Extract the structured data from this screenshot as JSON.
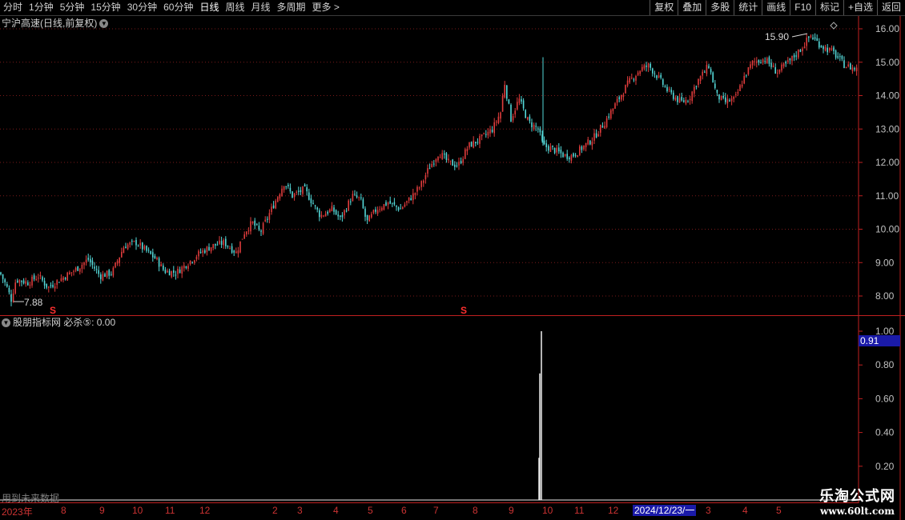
{
  "toolbar": {
    "periods": [
      "分时",
      "1分钟",
      "5分钟",
      "15分钟",
      "30分钟",
      "60分钟",
      "日线",
      "周线",
      "月线",
      "多周期",
      "更多 >"
    ],
    "active_period": "日线",
    "right_buttons": [
      "复权",
      "叠加",
      "多股",
      "统计",
      "画线",
      "F10",
      "标记",
      "+自选",
      "返回"
    ]
  },
  "main_chart": {
    "title": "宁沪高速(日线,前复权)",
    "high_label": "15.90",
    "low_label": "7.88",
    "y_ticks": [
      "16.00",
      "15.00",
      "14.00",
      "13.00",
      "12.00",
      "11.00",
      "10.00",
      "9.00",
      "8.00"
    ],
    "marker_symbol": "S",
    "up_color": "#e03c3c",
    "down_color": "#54d8d8"
  },
  "indicator": {
    "title": "股朋指标网 必杀⑤: 0.00",
    "y_ticks": [
      "1.00",
      "0.80",
      "0.60",
      "0.40",
      "0.20"
    ],
    "current_value_label": "0.91"
  },
  "date_axis": {
    "labels": [
      "2023年",
      "8",
      "9",
      "10",
      "11",
      "12",
      "2",
      "3",
      "4",
      "5",
      "6",
      "7",
      "8",
      "9",
      "10",
      "11",
      "12",
      "3",
      "4",
      "5"
    ],
    "highlight": "2024/12/23/一"
  },
  "future_note": "用到未来数据",
  "watermark": {
    "title": "乐淘公式网",
    "url": "www.60lt.com"
  },
  "chart_data": {
    "type": "candlestick",
    "title": "宁沪高速(日线,前复权)",
    "y_range": [
      7.6,
      16.2
    ],
    "grid": true,
    "close_anchors": [
      [
        0,
        8.7
      ],
      [
        8,
        8.3
      ],
      [
        14,
        7.9
      ],
      [
        20,
        8.5
      ],
      [
        35,
        8.4
      ],
      [
        48,
        8.6
      ],
      [
        60,
        8.25
      ],
      [
        75,
        8.5
      ],
      [
        95,
        8.8
      ],
      [
        110,
        9.1
      ],
      [
        125,
        8.6
      ],
      [
        140,
        8.7
      ],
      [
        155,
        9.5
      ],
      [
        170,
        9.6
      ],
      [
        185,
        9.3
      ],
      [
        195,
        9.1
      ],
      [
        205,
        8.75
      ],
      [
        220,
        8.7
      ],
      [
        235,
        9.0
      ],
      [
        250,
        9.3
      ],
      [
        265,
        9.5
      ],
      [
        280,
        9.6
      ],
      [
        295,
        9.3
      ],
      [
        305,
        9.9
      ],
      [
        315,
        10.2
      ],
      [
        325,
        9.9
      ],
      [
        335,
        10.4
      ],
      [
        345,
        10.9
      ],
      [
        355,
        11.4
      ],
      [
        365,
        11.0
      ],
      [
        380,
        11.2
      ],
      [
        390,
        10.8
      ],
      [
        400,
        10.4
      ],
      [
        415,
        10.6
      ],
      [
        425,
        10.3
      ],
      [
        440,
        11.0
      ],
      [
        450,
        10.9
      ],
      [
        458,
        10.2
      ],
      [
        470,
        10.6
      ],
      [
        485,
        10.8
      ],
      [
        500,
        10.6
      ],
      [
        515,
        11.0
      ],
      [
        525,
        11.3
      ],
      [
        535,
        11.8
      ],
      [
        548,
        12.3
      ],
      [
        560,
        12.0
      ],
      [
        572,
        11.9
      ],
      [
        585,
        12.5
      ],
      [
        600,
        12.7
      ],
      [
        615,
        13.0
      ],
      [
        625,
        13.5
      ],
      [
        630,
        14.4
      ],
      [
        638,
        13.3
      ],
      [
        648,
        13.9
      ],
      [
        660,
        13.2
      ],
      [
        672,
        13.0
      ],
      [
        678,
        12.5
      ],
      [
        690,
        12.4
      ],
      [
        705,
        12.2
      ],
      [
        715,
        12.2
      ],
      [
        725,
        12.4
      ],
      [
        740,
        12.7
      ],
      [
        755,
        13.2
      ],
      [
        770,
        13.8
      ],
      [
        785,
        14.4
      ],
      [
        800,
        14.8
      ],
      [
        810,
        14.9
      ],
      [
        820,
        14.6
      ],
      [
        835,
        14.1
      ],
      [
        850,
        13.8
      ],
      [
        860,
        13.9
      ],
      [
        870,
        14.4
      ],
      [
        885,
        14.9
      ],
      [
        895,
        14.0
      ],
      [
        905,
        13.8
      ],
      [
        918,
        13.9
      ],
      [
        930,
        14.6
      ],
      [
        940,
        15.0
      ],
      [
        955,
        15.1
      ],
      [
        970,
        14.7
      ],
      [
        985,
        15.0
      ],
      [
        1000,
        15.4
      ],
      [
        1012,
        15.8
      ],
      [
        1025,
        15.5
      ],
      [
        1040,
        15.3
      ],
      [
        1055,
        14.9
      ],
      [
        1068,
        14.8
      ]
    ],
    "indicator_series": {
      "name": "必杀⑤",
      "spikes": [
        {
          "date_position": "2024-09 (near 10)",
          "value": 1.0
        },
        {
          "date_position": "2024-09 (near 10)",
          "value": 0.75
        },
        {
          "date_position": "2024-09 (near 10)",
          "value": 0.25
        }
      ],
      "current": 0.0
    }
  }
}
